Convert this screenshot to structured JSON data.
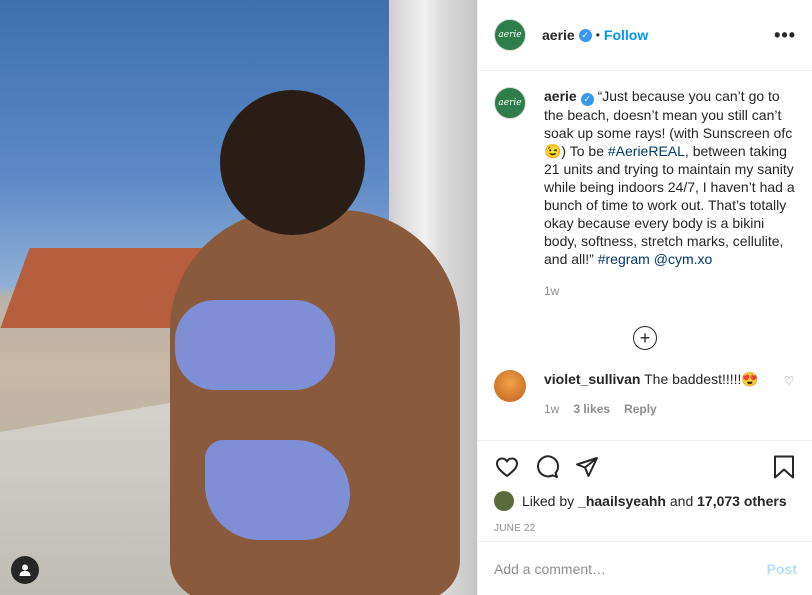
{
  "header": {
    "username": "aerie",
    "avatar_text": "aerie",
    "verified": true,
    "dot": "•",
    "follow_label": "Follow",
    "more_label": "•••"
  },
  "caption": {
    "username": "aerie",
    "avatar_text": "aerie",
    "text_1": "“Just because you can’t go to the beach, doesn’t mean you still can’t soak up some rays! (with Sunscreen ofc 😉) To be ",
    "hashtag_1": "#AerieREAL",
    "text_2": ", between taking 21 units and trying to maintain my sanity while being indoors 24/7, I haven’t had a bunch of time to work out. That’s totally okay because every body is a bikini body, softness, stretch marks, cellulite, and all!” ",
    "hashtag_2": "#regram",
    "mention": "@cym.xo",
    "time": "1w"
  },
  "load_more_label": "+",
  "comments": [
    {
      "username": "violet_sullivan",
      "text": "The baddest!!!!!😍",
      "time": "1w",
      "likes": "3 likes",
      "reply_label": "Reply"
    }
  ],
  "likes": {
    "prefix": "Liked by ",
    "user": "_haailsyeahh",
    "and": " and ",
    "count": "17,073 others"
  },
  "date": "JUNE 22",
  "add_comment": {
    "placeholder": "Add a comment…",
    "post_label": "Post"
  },
  "colors": {
    "follow_blue": "#0095f6",
    "post_disabled": "#b2dffc",
    "verified_blue": "#3897f0",
    "brand_green": "#2e7d4a"
  }
}
